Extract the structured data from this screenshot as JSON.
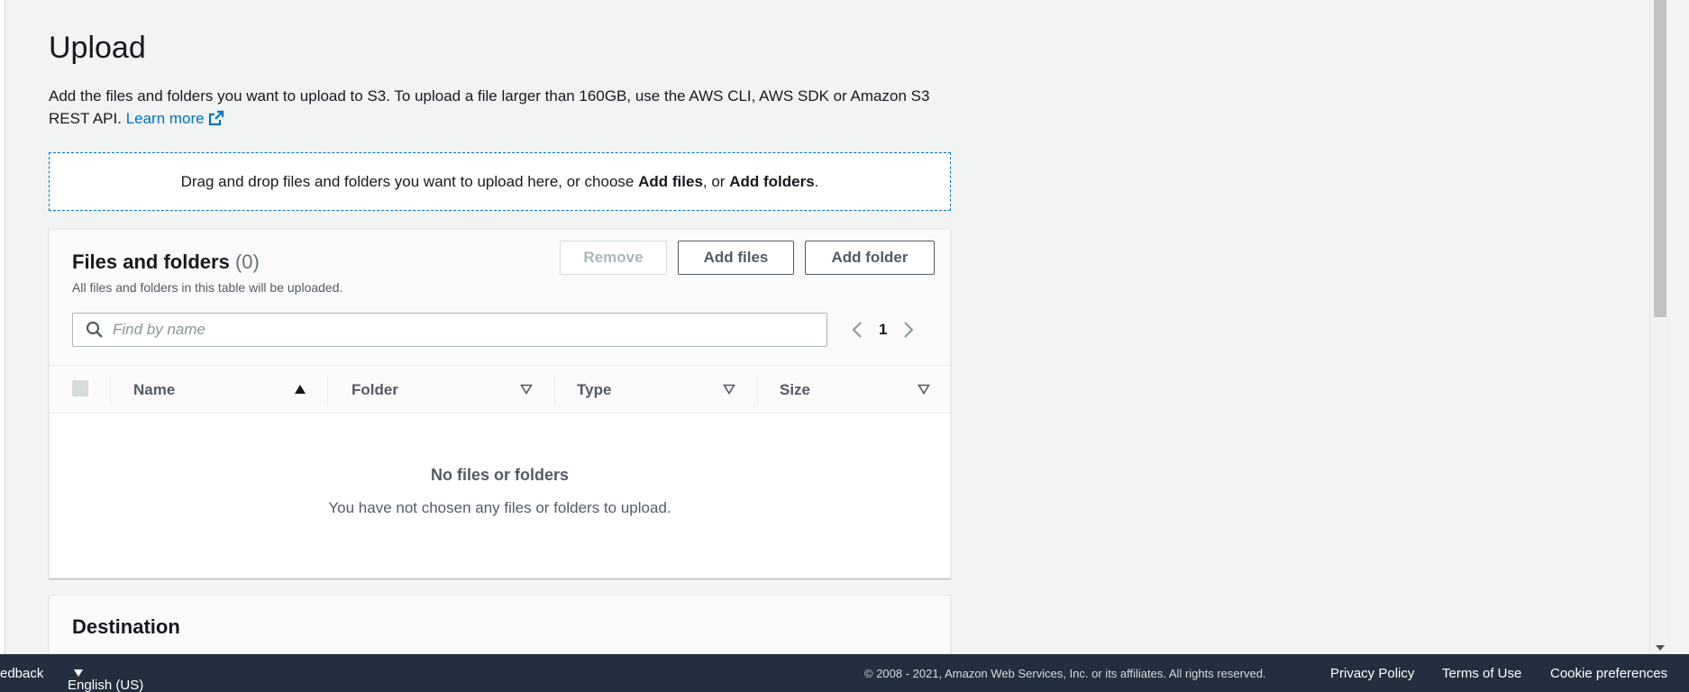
{
  "page": {
    "title": "Upload",
    "description_main": "Add the files and folders you want to upload to S3. To upload a file larger than 160GB, use the AWS CLI, AWS SDK or Amazon S3 REST API.",
    "learn_more": "Learn more"
  },
  "dropzone": {
    "text_before": "Drag and drop files and folders you want to upload here, or choose ",
    "add_files": "Add files",
    "text_middle": ", or ",
    "add_folders": "Add folders",
    "text_after": "."
  },
  "files_panel": {
    "title": "Files and folders",
    "count": "(0)",
    "subtitle": "All files and folders in this table will be uploaded.",
    "remove_button": "Remove",
    "add_files_button": "Add files",
    "add_folder_button": "Add folder",
    "search_placeholder": "Find by name",
    "page_number": "1",
    "columns": [
      "Name",
      "Folder",
      "Type",
      "Size"
    ],
    "empty_title": "No files or folders",
    "empty_description": "You have not chosen any files or folders to upload."
  },
  "destination_panel": {
    "title": "Destination"
  },
  "footer": {
    "feedback": "edback",
    "language": "English (US)",
    "copyright": "© 2008 - 2021, Amazon Web Services, Inc. or its affiliates. All rights reserved.",
    "privacy": "Privacy Policy",
    "terms": "Terms of Use",
    "cookies": "Cookie preferences"
  },
  "colors": {
    "link": "#0073bb",
    "footer_bg": "#232f3e",
    "background": "#f2f3f3"
  },
  "icons": {
    "external": "external-link-icon",
    "search": "search-icon",
    "sort_asc": "caret-up-icon",
    "sort_none": "caret-down-outline-icon",
    "prev": "chevron-left-icon",
    "next": "chevron-right-icon",
    "lang": "caret-down-icon"
  }
}
